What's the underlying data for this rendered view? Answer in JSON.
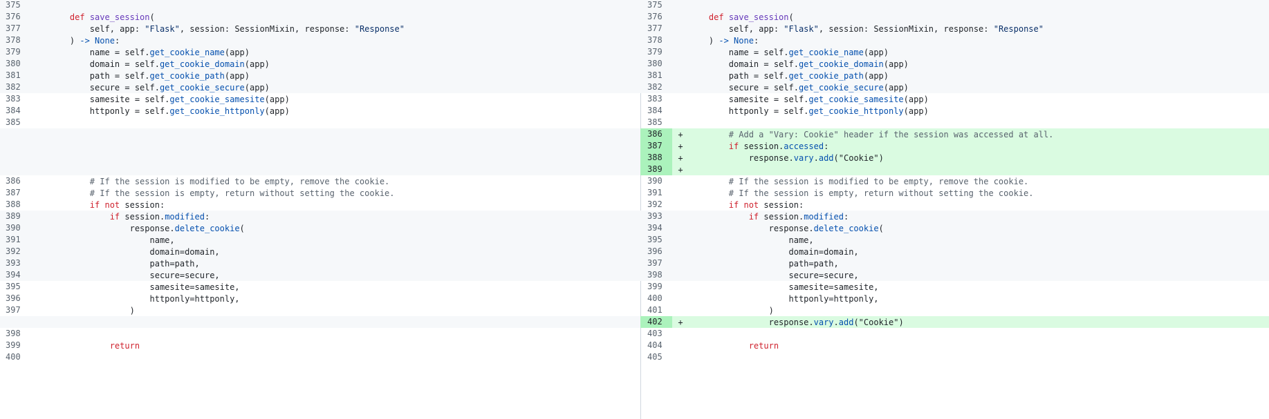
{
  "colors": {
    "added_bg": "#dafbe1",
    "added_gutter": "#abf2bc",
    "hunk_bg": "#f6f8fa",
    "keyword": "#cf222e",
    "function": "#6639ba",
    "string": "#0a3069",
    "attribute": "#0550ae",
    "comment": "#59636e"
  },
  "left": [
    {
      "type": "ctx",
      "num": "375",
      "bg": "alt",
      "code": []
    },
    {
      "type": "ctx",
      "num": "376",
      "bg": "alt",
      "code": [
        [
          "t",
          "    "
        ],
        [
          "kw",
          "def "
        ],
        [
          "fn",
          "save_session"
        ],
        [
          "t",
          "("
        ]
      ]
    },
    {
      "type": "ctx",
      "num": "377",
      "bg": "alt",
      "code": [
        [
          "t",
          "        self, app: "
        ],
        [
          "str",
          "\"Flask\""
        ],
        [
          "t",
          ", session: SessionMixin, response: "
        ],
        [
          "str",
          "\"Response\""
        ]
      ]
    },
    {
      "type": "ctx",
      "num": "378",
      "bg": "alt",
      "code": [
        [
          "t",
          "    ) "
        ],
        [
          "attr",
          "-> None"
        ],
        [
          "t",
          ":"
        ]
      ]
    },
    {
      "type": "ctx",
      "num": "379",
      "bg": "alt",
      "code": [
        [
          "t",
          "        name = self."
        ],
        [
          "attr",
          "get_cookie_name"
        ],
        [
          "t",
          "(app)"
        ]
      ]
    },
    {
      "type": "ctx",
      "num": "380",
      "bg": "alt",
      "code": [
        [
          "t",
          "        domain = self."
        ],
        [
          "attr",
          "get_cookie_domain"
        ],
        [
          "t",
          "(app)"
        ]
      ]
    },
    {
      "type": "ctx",
      "num": "381",
      "bg": "alt",
      "code": [
        [
          "t",
          "        path = self."
        ],
        [
          "attr",
          "get_cookie_path"
        ],
        [
          "t",
          "(app)"
        ]
      ]
    },
    {
      "type": "ctx",
      "num": "382",
      "bg": "alt",
      "code": [
        [
          "t",
          "        secure = self."
        ],
        [
          "attr",
          "get_cookie_secure"
        ],
        [
          "t",
          "(app)"
        ]
      ]
    },
    {
      "type": "ctx",
      "num": "383",
      "bg": "",
      "code": [
        [
          "t",
          "        samesite = self."
        ],
        [
          "attr",
          "get_cookie_samesite"
        ],
        [
          "t",
          "(app)"
        ]
      ]
    },
    {
      "type": "ctx",
      "num": "384",
      "bg": "",
      "code": [
        [
          "t",
          "        httponly = self."
        ],
        [
          "attr",
          "get_cookie_httponly"
        ],
        [
          "t",
          "(app)"
        ]
      ]
    },
    {
      "type": "ctx",
      "num": "385",
      "bg": "",
      "code": []
    },
    {
      "type": "filler"
    },
    {
      "type": "filler"
    },
    {
      "type": "filler"
    },
    {
      "type": "filler"
    },
    {
      "type": "ctx",
      "num": "386",
      "bg": "",
      "code": [
        [
          "cm",
          "        # If the session is modified to be empty, remove the cookie."
        ]
      ]
    },
    {
      "type": "ctx",
      "num": "387",
      "bg": "",
      "code": [
        [
          "cm",
          "        # If the session is empty, return without setting the cookie."
        ]
      ]
    },
    {
      "type": "ctx",
      "num": "388",
      "bg": "",
      "code": [
        [
          "t",
          "        "
        ],
        [
          "kw",
          "if not "
        ],
        [
          "t",
          "session:"
        ]
      ]
    },
    {
      "type": "ctx",
      "num": "389",
      "bg": "alt",
      "code": [
        [
          "t",
          "            "
        ],
        [
          "kw",
          "if "
        ],
        [
          "t",
          "session."
        ],
        [
          "attr",
          "modified"
        ],
        [
          "t",
          ":"
        ]
      ]
    },
    {
      "type": "ctx",
      "num": "390",
      "bg": "alt",
      "code": [
        [
          "t",
          "                response."
        ],
        [
          "attr",
          "delete_cookie"
        ],
        [
          "t",
          "("
        ]
      ]
    },
    {
      "type": "ctx",
      "num": "391",
      "bg": "alt",
      "code": [
        [
          "t",
          "                    name,"
        ]
      ]
    },
    {
      "type": "ctx",
      "num": "392",
      "bg": "alt",
      "code": [
        [
          "t",
          "                    domain=domain,"
        ]
      ]
    },
    {
      "type": "ctx",
      "num": "393",
      "bg": "alt",
      "code": [
        [
          "t",
          "                    path=path,"
        ]
      ]
    },
    {
      "type": "ctx",
      "num": "394",
      "bg": "alt",
      "code": [
        [
          "t",
          "                    secure=secure,"
        ]
      ]
    },
    {
      "type": "ctx",
      "num": "395",
      "bg": "",
      "code": [
        [
          "t",
          "                    samesite=samesite,"
        ]
      ]
    },
    {
      "type": "ctx",
      "num": "396",
      "bg": "",
      "code": [
        [
          "t",
          "                    httponly=httponly,"
        ]
      ]
    },
    {
      "type": "ctx",
      "num": "397",
      "bg": "",
      "code": [
        [
          "t",
          "                )"
        ]
      ]
    },
    {
      "type": "filler"
    },
    {
      "type": "ctx",
      "num": "398",
      "bg": "",
      "code": []
    },
    {
      "type": "ctx",
      "num": "399",
      "bg": "",
      "code": [
        [
          "t",
          "            "
        ],
        [
          "kw",
          "return"
        ]
      ]
    },
    {
      "type": "ctx",
      "num": "400",
      "bg": "",
      "code": []
    }
  ],
  "right": [
    {
      "type": "ctx",
      "num": "375",
      "bg": "alt",
      "code": []
    },
    {
      "type": "ctx",
      "num": "376",
      "bg": "alt",
      "code": [
        [
          "t",
          "    "
        ],
        [
          "kw",
          "def "
        ],
        [
          "fn",
          "save_session"
        ],
        [
          "t",
          "("
        ]
      ]
    },
    {
      "type": "ctx",
      "num": "377",
      "bg": "alt",
      "code": [
        [
          "t",
          "        self, app: "
        ],
        [
          "str",
          "\"Flask\""
        ],
        [
          "t",
          ", session: SessionMixin, response: "
        ],
        [
          "str",
          "\"Response\""
        ]
      ]
    },
    {
      "type": "ctx",
      "num": "378",
      "bg": "alt",
      "code": [
        [
          "t",
          "    ) "
        ],
        [
          "attr",
          "-> None"
        ],
        [
          "t",
          ":"
        ]
      ]
    },
    {
      "type": "ctx",
      "num": "379",
      "bg": "alt",
      "code": [
        [
          "t",
          "        name = self."
        ],
        [
          "attr",
          "get_cookie_name"
        ],
        [
          "t",
          "(app)"
        ]
      ]
    },
    {
      "type": "ctx",
      "num": "380",
      "bg": "alt",
      "code": [
        [
          "t",
          "        domain = self."
        ],
        [
          "attr",
          "get_cookie_domain"
        ],
        [
          "t",
          "(app)"
        ]
      ]
    },
    {
      "type": "ctx",
      "num": "381",
      "bg": "alt",
      "code": [
        [
          "t",
          "        path = self."
        ],
        [
          "attr",
          "get_cookie_path"
        ],
        [
          "t",
          "(app)"
        ]
      ]
    },
    {
      "type": "ctx",
      "num": "382",
      "bg": "alt",
      "code": [
        [
          "t",
          "        secure = self."
        ],
        [
          "attr",
          "get_cookie_secure"
        ],
        [
          "t",
          "(app)"
        ]
      ]
    },
    {
      "type": "ctx",
      "num": "383",
      "bg": "",
      "code": [
        [
          "t",
          "        samesite = self."
        ],
        [
          "attr",
          "get_cookie_samesite"
        ],
        [
          "t",
          "(app)"
        ]
      ]
    },
    {
      "type": "ctx",
      "num": "384",
      "bg": "",
      "code": [
        [
          "t",
          "        httponly = self."
        ],
        [
          "attr",
          "get_cookie_httponly"
        ],
        [
          "t",
          "(app)"
        ]
      ]
    },
    {
      "type": "ctx",
      "num": "385",
      "bg": "",
      "code": []
    },
    {
      "type": "add",
      "num": "386",
      "marker": "+",
      "code": [
        [
          "cm",
          "        # Add a \"Vary: Cookie\" header if the session was accessed at all."
        ]
      ]
    },
    {
      "type": "add",
      "num": "387",
      "marker": "+",
      "code": [
        [
          "t",
          "        "
        ],
        [
          "kw",
          "if "
        ],
        [
          "t",
          "session."
        ],
        [
          "attr",
          "accessed"
        ],
        [
          "t",
          ":"
        ]
      ]
    },
    {
      "type": "add",
      "num": "388",
      "marker": "+",
      "code": [
        [
          "t",
          "            response."
        ],
        [
          "attr",
          "vary"
        ],
        [
          "t",
          "."
        ],
        [
          "attr",
          "add"
        ],
        [
          "t",
          "(\"Cookie\")"
        ]
      ]
    },
    {
      "type": "add",
      "num": "389",
      "marker": "+",
      "code": []
    },
    {
      "type": "ctx",
      "num": "390",
      "bg": "",
      "code": [
        [
          "cm",
          "        # If the session is modified to be empty, remove the cookie."
        ]
      ]
    },
    {
      "type": "ctx",
      "num": "391",
      "bg": "",
      "code": [
        [
          "cm",
          "        # If the session is empty, return without setting the cookie."
        ]
      ]
    },
    {
      "type": "ctx",
      "num": "392",
      "bg": "",
      "code": [
        [
          "t",
          "        "
        ],
        [
          "kw",
          "if not "
        ],
        [
          "t",
          "session:"
        ]
      ]
    },
    {
      "type": "ctx",
      "num": "393",
      "bg": "alt",
      "code": [
        [
          "t",
          "            "
        ],
        [
          "kw",
          "if "
        ],
        [
          "t",
          "session."
        ],
        [
          "attr",
          "modified"
        ],
        [
          "t",
          ":"
        ]
      ]
    },
    {
      "type": "ctx",
      "num": "394",
      "bg": "alt",
      "code": [
        [
          "t",
          "                response."
        ],
        [
          "attr",
          "delete_cookie"
        ],
        [
          "t",
          "("
        ]
      ]
    },
    {
      "type": "ctx",
      "num": "395",
      "bg": "alt",
      "code": [
        [
          "t",
          "                    name,"
        ]
      ]
    },
    {
      "type": "ctx",
      "num": "396",
      "bg": "alt",
      "code": [
        [
          "t",
          "                    domain=domain,"
        ]
      ]
    },
    {
      "type": "ctx",
      "num": "397",
      "bg": "alt",
      "code": [
        [
          "t",
          "                    path=path,"
        ]
      ]
    },
    {
      "type": "ctx",
      "num": "398",
      "bg": "alt",
      "code": [
        [
          "t",
          "                    secure=secure,"
        ]
      ]
    },
    {
      "type": "ctx",
      "num": "399",
      "bg": "",
      "code": [
        [
          "t",
          "                    samesite=samesite,"
        ]
      ]
    },
    {
      "type": "ctx",
      "num": "400",
      "bg": "",
      "code": [
        [
          "t",
          "                    httponly=httponly,"
        ]
      ]
    },
    {
      "type": "ctx",
      "num": "401",
      "bg": "",
      "code": [
        [
          "t",
          "                )"
        ]
      ]
    },
    {
      "type": "add",
      "num": "402",
      "marker": "+",
      "code": [
        [
          "t",
          "                response."
        ],
        [
          "attr",
          "vary"
        ],
        [
          "t",
          "."
        ],
        [
          "attr",
          "add"
        ],
        [
          "t",
          "(\"Cookie\")"
        ]
      ]
    },
    {
      "type": "ctx",
      "num": "403",
      "bg": "",
      "code": []
    },
    {
      "type": "ctx",
      "num": "404",
      "bg": "",
      "code": [
        [
          "t",
          "            "
        ],
        [
          "kw",
          "return"
        ]
      ]
    },
    {
      "type": "ctx",
      "num": "405",
      "bg": "",
      "code": []
    }
  ]
}
